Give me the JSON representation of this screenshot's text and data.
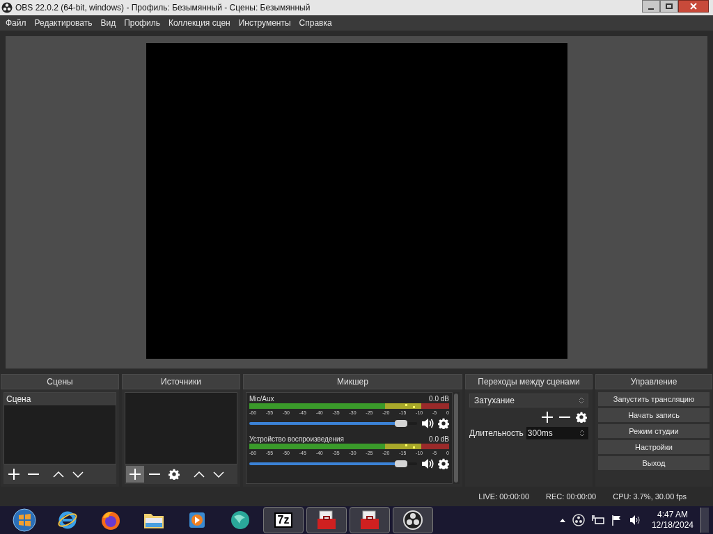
{
  "window": {
    "title": "OBS 22.0.2 (64-bit, windows) - Профиль: Безымянный - Сцены: Безымянный"
  },
  "menu": [
    "Файл",
    "Редактировать",
    "Вид",
    "Профиль",
    "Коллекция сцен",
    "Инструменты",
    "Справка"
  ],
  "scenes": {
    "title": "Сцены",
    "items": [
      {
        "label": "Сцена",
        "selected": true
      }
    ],
    "toolbar": [
      {
        "kind": "add",
        "highlighted": false
      },
      {
        "kind": "remove",
        "highlighted": false
      },
      {
        "kind": "up",
        "highlighted": false
      },
      {
        "kind": "down",
        "highlighted": false
      }
    ]
  },
  "sources": {
    "title": "Источники",
    "toolbar": [
      {
        "kind": "add",
        "highlighted": true
      },
      {
        "kind": "remove",
        "highlighted": false
      },
      {
        "kind": "settings",
        "highlighted": false
      },
      {
        "kind": "up",
        "highlighted": false
      },
      {
        "kind": "down",
        "highlighted": false
      }
    ]
  },
  "mixer": {
    "title": "Микшер",
    "channels": [
      {
        "name": "Mic/Aux",
        "reading": "0.0 dB",
        "level": 0.94,
        "muted": false,
        "ticks": [
          "-60",
          "-55",
          "-50",
          "-45",
          "-40",
          "-35",
          "-30",
          "-25",
          "-20",
          "-15",
          "-10",
          "-5",
          "0"
        ]
      },
      {
        "name": "Устройство воспроизведения",
        "reading": "0.0 dB",
        "level": 0.94,
        "muted": false,
        "ticks": [
          "-60",
          "-55",
          "-50",
          "-45",
          "-40",
          "-35",
          "-30",
          "-25",
          "-20",
          "-15",
          "-10",
          "-5",
          "0"
        ]
      }
    ]
  },
  "transitions": {
    "title": "Переходы между сценами",
    "selected_transition": "Затухание",
    "duration_label": "Длительность",
    "duration": "300ms"
  },
  "controls": {
    "title": "Управление",
    "buttons": [
      "Запустить трансляцию",
      "Начать запись",
      "Режим студии",
      "Настройки",
      "Выход"
    ]
  },
  "status_bar": [
    "LIVE: 00:00:00",
    "REC: 00:00:00",
    "CPU: 3.7%, 30.00 fps"
  ],
  "taskbar": {
    "apps": [
      {
        "kind": "start",
        "active": false
      },
      {
        "kind": "ie",
        "active": false
      },
      {
        "kind": "firefox",
        "active": false
      },
      {
        "kind": "folder",
        "active": false
      },
      {
        "kind": "player",
        "active": false
      },
      {
        "kind": "globe",
        "active": false
      },
      {
        "kind": "sevenzip",
        "label": "7z",
        "active": true
      },
      {
        "kind": "toolbox",
        "active": true
      },
      {
        "kind": "toolbox",
        "active": true
      },
      {
        "kind": "obs",
        "active": true
      }
    ],
    "time": "4:47 AM",
    "date": "12/18/2024"
  }
}
